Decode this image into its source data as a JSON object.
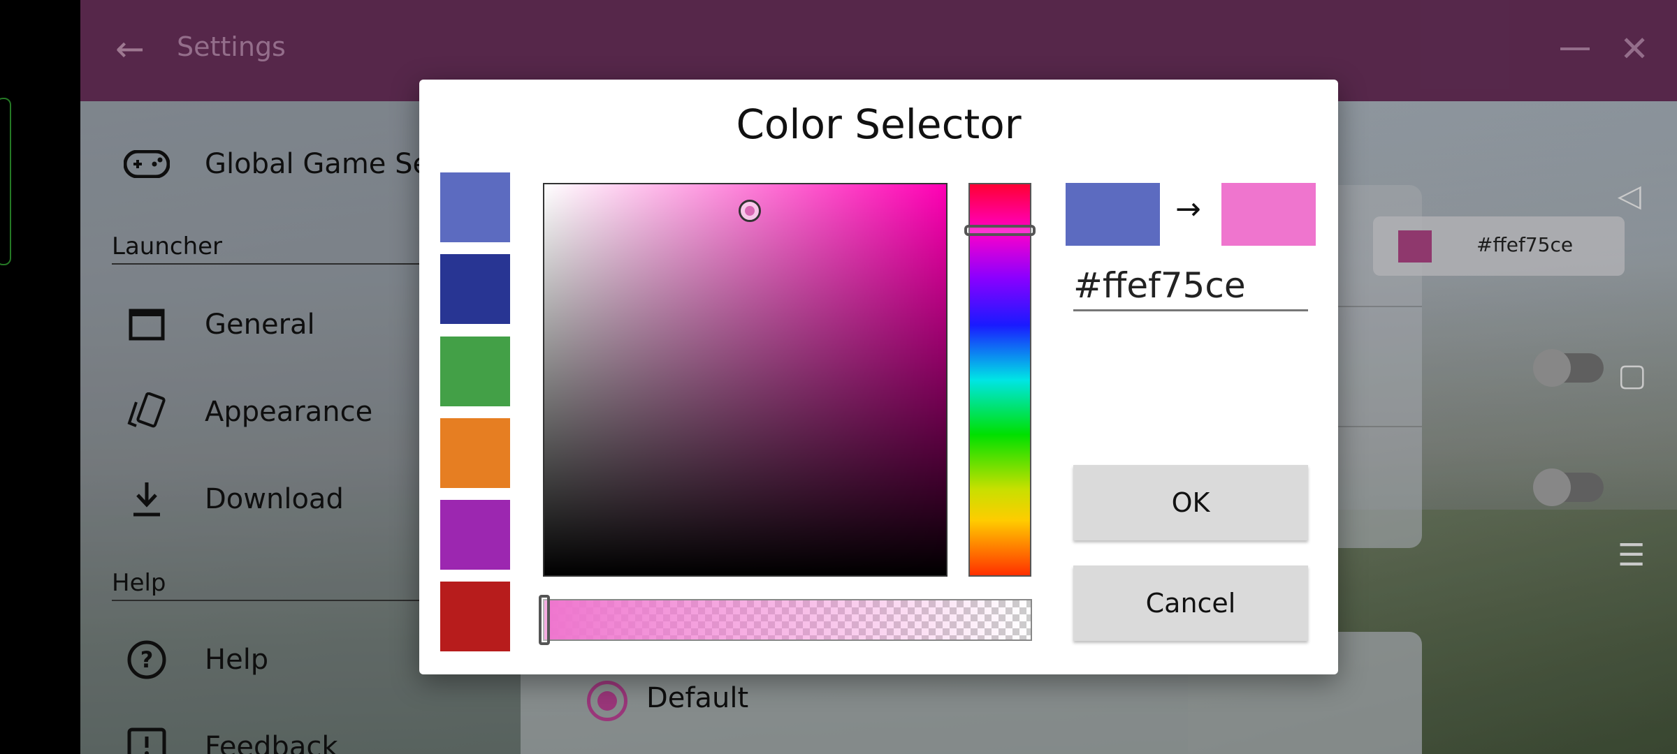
{
  "app": {
    "title": "Settings",
    "back_icon": "arrow-left-icon",
    "minimize_icon": "minimize-icon",
    "close_icon": "close-icon"
  },
  "sidebar": {
    "items": [
      {
        "label": "Global Game Se",
        "icon": "gamepad-icon"
      },
      {
        "label": "General",
        "icon": "window-icon"
      },
      {
        "label": "Appearance",
        "icon": "cards-icon"
      },
      {
        "label": "Download",
        "icon": "download-icon"
      },
      {
        "label": "Help",
        "icon": "help-circle-icon"
      },
      {
        "label": "Feedback",
        "icon": "feedback-icon"
      }
    ],
    "sections": [
      "Launcher",
      "Help"
    ]
  },
  "background_panel": {
    "color_chip_hex": "#ffef75ce",
    "color_chip_color": "#a3407d",
    "toggles": [
      false,
      false
    ],
    "radio_label": "Default"
  },
  "dialog": {
    "title": "Color Selector",
    "presets": [
      "#5c6bc0",
      "#283593",
      "#43a047",
      "#e67e22",
      "#9c27b0",
      "#b71c1c"
    ],
    "old_color": "#5c6bc0",
    "new_color": "#ef75ce",
    "arrow": "→",
    "hex_value": "#ffef75ce",
    "ok_label": "OK",
    "cancel_label": "Cancel"
  }
}
